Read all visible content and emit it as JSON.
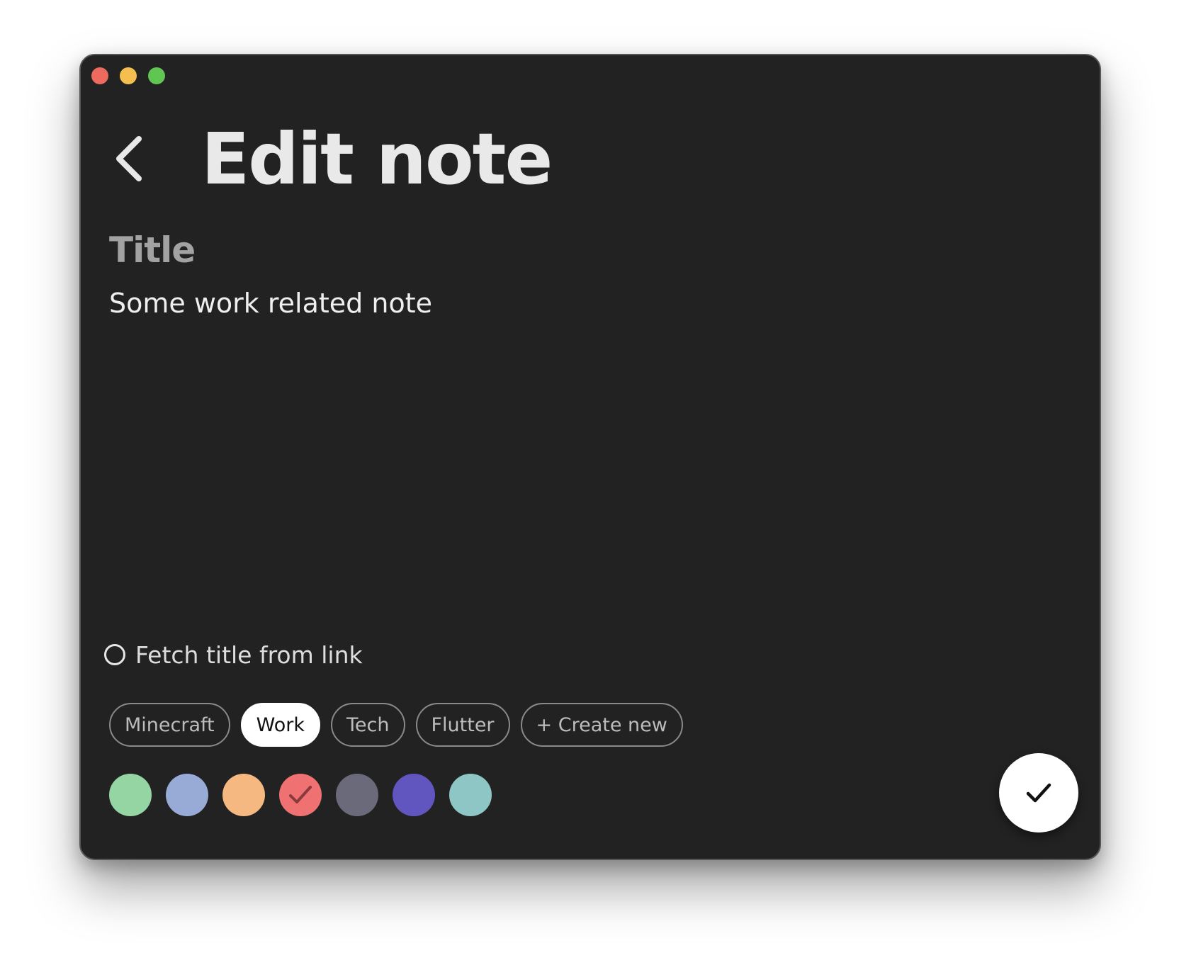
{
  "window": {
    "traffic_lights": [
      {
        "name": "close",
        "color": "#ed6a5e"
      },
      {
        "name": "minimize",
        "color": "#f5bf4f"
      },
      {
        "name": "maximize",
        "color": "#61c554"
      }
    ]
  },
  "header": {
    "back_icon": "chevron-left-icon",
    "title": "Edit note"
  },
  "form": {
    "title_label": "Title",
    "title_value": "Some work related note",
    "fetch_title_label": "Fetch title from link",
    "fetch_title_checked": false
  },
  "tags": [
    {
      "label": "Minecraft",
      "selected": false
    },
    {
      "label": "Work",
      "selected": true
    },
    {
      "label": "Tech",
      "selected": false
    },
    {
      "label": "Flutter",
      "selected": false
    },
    {
      "label": "+ Create new",
      "selected": false
    }
  ],
  "colors": [
    {
      "hex": "#95d5a4",
      "selected": false
    },
    {
      "hex": "#97abd6",
      "selected": false
    },
    {
      "hex": "#f4b880",
      "selected": false
    },
    {
      "hex": "#ef7172",
      "selected": true
    },
    {
      "hex": "#6a6a7a",
      "selected": false
    },
    {
      "hex": "#6156bf",
      "selected": false
    },
    {
      "hex": "#8ec6c6",
      "selected": false
    }
  ],
  "save_button": {
    "icon": "checkmark-icon"
  },
  "theme": {
    "background": "#222222",
    "text_primary": "#e9e9e9",
    "text_muted": "#a2a2a2"
  }
}
